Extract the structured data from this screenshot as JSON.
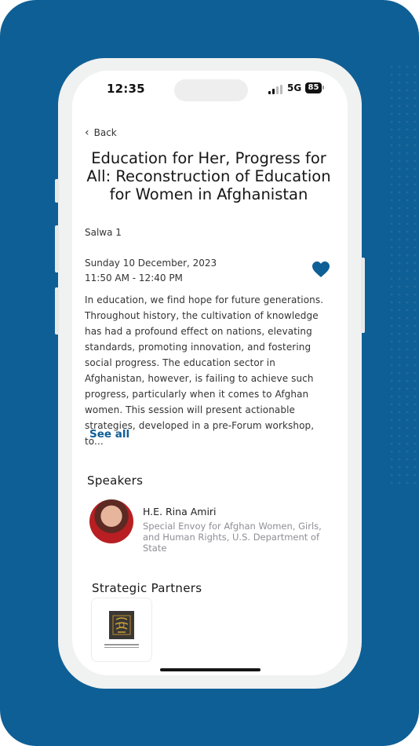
{
  "status_bar": {
    "time": "12:35",
    "network": "5G",
    "battery": "85"
  },
  "nav": {
    "back_label": "Back"
  },
  "session": {
    "title": "Education for Her, Progress for All: Reconstruction of Education for Women in Afghanistan",
    "room": "Salwa 1",
    "date": "Sunday 10 December, 2023",
    "time_range": "11:50 AM - 12:40 PM",
    "description": "In education, we find hope for future generations. Throughout history, the cultivation of knowledge has had a profound effect on nations, elevating standards, promoting innovation, and fostering social progress. The education sector in Afghanistan, however, is failing to achieve such progress, particularly when it comes to Afghan women. This session will present actionable strategies, developed in a pre-Forum workshop, to...",
    "see_all_label": "See all"
  },
  "speakers": {
    "heading": "Speakers",
    "items": [
      {
        "name": "H.E. Rina Amiri",
        "role": "Special Envoy for Afghan Women, Girls, and Human Rights, U.S. Department of State"
      }
    ]
  },
  "partners": {
    "heading": "Strategic Partners"
  },
  "colors": {
    "brand": "#0e5f95",
    "accent": "#0f5e96",
    "muted": "#8e8e96"
  },
  "icons": {
    "back": "chevron-left-icon",
    "favorite": "heart-icon"
  }
}
